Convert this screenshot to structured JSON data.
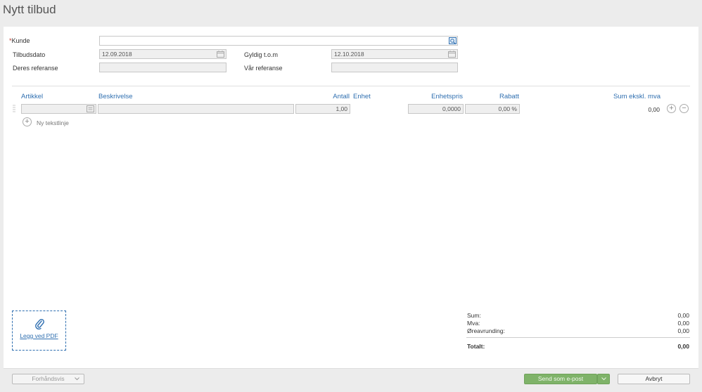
{
  "page": {
    "title": "Nytt tilbud"
  },
  "form": {
    "customer_label": "Kunde",
    "customer_required_mark": "*",
    "customer_value": "",
    "offer_date_label": "Tilbudsdato",
    "offer_date_value": "12.09.2018",
    "valid_until_label": "Gyldig t.o.m",
    "valid_until_value": "12.10.2018",
    "their_ref_label": "Deres referanse",
    "their_ref_value": "",
    "our_ref_label": "Vår referanse",
    "our_ref_value": ""
  },
  "lines": {
    "headers": {
      "article": "Artikkel",
      "description": "Beskrivelse",
      "quantity": "Antall",
      "unit": "Enhet",
      "unit_price": "Enhetspris",
      "discount": "Rabatt",
      "sum": "Sum ekskl. mva"
    },
    "rows": [
      {
        "article": "",
        "description": "",
        "quantity": "1,00",
        "unit": "",
        "unit_price": "0,0000",
        "discount": "0,00 %",
        "sum": "0,00"
      }
    ],
    "add_text_line_label": "Ny tekstlinje",
    "add_icon": "+",
    "remove_icon": "−"
  },
  "attachment": {
    "label": "Legg ved PDF",
    "icon": "paperclip-icon"
  },
  "totals": {
    "sum_label": "Sum:",
    "sum_value": "0,00",
    "vat_label": "Mva:",
    "vat_value": "0,00",
    "rounding_label": "Øreavrunding:",
    "rounding_value": "0,00",
    "total_label": "Totalt:",
    "total_value": "0,00"
  },
  "footer": {
    "preview_label": "Forhåndsvis",
    "send_email_label": "Send som e-post",
    "cancel_label": "Avbryt"
  },
  "colors": {
    "link": "#2f6fb0",
    "send_button": "#7fb369",
    "required": "#c0392b"
  }
}
